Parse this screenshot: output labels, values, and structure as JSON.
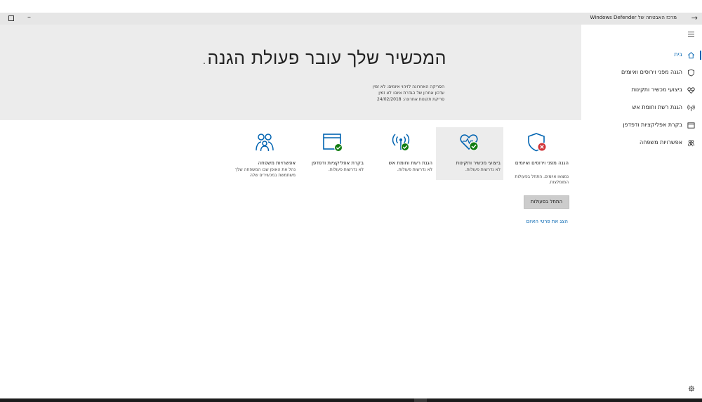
{
  "window": {
    "title": "מרכז האבטחה של Windows Defender",
    "back_icon": "back-arrow-icon",
    "minimize_label": "–"
  },
  "hero": {
    "title": "המכשיר שלך עובר פעולת הגנה.",
    "lines": [
      "הסריקה האחרונה לזיהוי איומים: לא זמין",
      "עדכון אחרון של הגדרת איום: לא זמין",
      "סריקת תקינות אחרונה: 24/02/2018"
    ]
  },
  "sidebar": {
    "items": [
      {
        "label": "בית",
        "icon": "home-icon",
        "active": true
      },
      {
        "label": "הגנה מפני וירוסים ואיומים",
        "icon": "shield-icon",
        "active": false
      },
      {
        "label": "ביצועי מכשיר ותקינות",
        "icon": "heart-icon",
        "active": false
      },
      {
        "label": "הגנת רשת וחומת אש",
        "icon": "wireless-icon",
        "active": false
      },
      {
        "label": "בקרת אפליקציות ודפדפן",
        "icon": "browser-window-icon",
        "active": false
      },
      {
        "label": "אפשרויות משפחה",
        "icon": "family-icon",
        "active": false
      }
    ],
    "settings_icon": "gear-icon"
  },
  "tiles": [
    {
      "title": "הגנה מפני וירוסים ואיומים",
      "subtitle": "נמצאו איומים. התחל בפעולות המומלצות.",
      "status": "error",
      "highlighted": false
    },
    {
      "title": "ביצועי מכשיר ותקינות",
      "subtitle": "לא נדרשות פעולות.",
      "status": "ok",
      "highlighted": true
    },
    {
      "title": "הגנת רשת וחומת אש",
      "subtitle": "לא נדרשות פעולות.",
      "status": "ok",
      "highlighted": false
    },
    {
      "title": "בקרת אפליקציות ודפדפן",
      "subtitle": "לא נדרשות פעולות.",
      "status": "ok",
      "highlighted": false
    },
    {
      "title": "אפשרויות משפחה",
      "subtitle": "נהל את האופן שבו המשפחה שלך משתמשת במכשירים שלה",
      "status": "none",
      "highlighted": false
    }
  ],
  "actions": {
    "start_actions_label": "התחל בפעולות",
    "threat_details_link": "הצג את פרטי האיום"
  },
  "colors": {
    "accent": "#0063b1",
    "ok": "#107c10",
    "error": "#d13438"
  }
}
